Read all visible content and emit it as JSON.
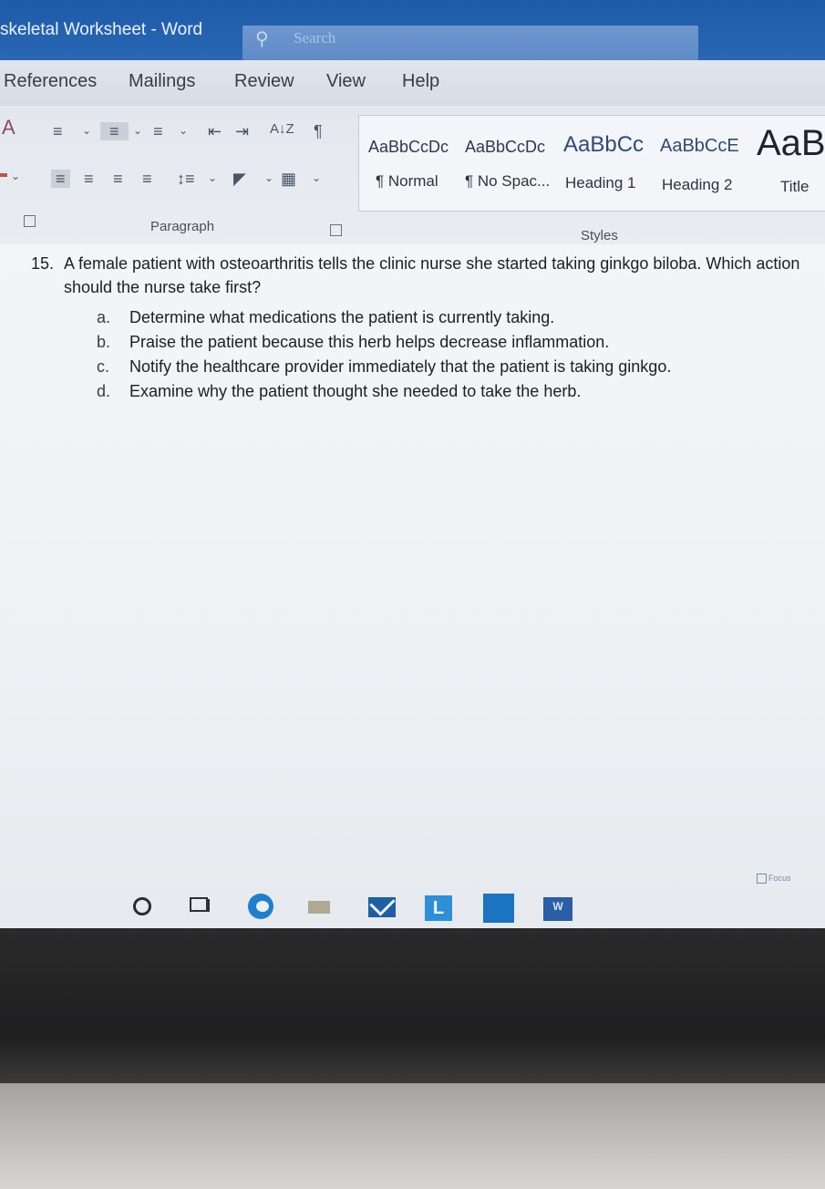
{
  "window": {
    "title": "skeletal Worksheet  -  Word"
  },
  "search": {
    "icon": "search-icon",
    "placeholder": "Search"
  },
  "tabs": [
    {
      "label": "References"
    },
    {
      "label": "Mailings"
    },
    {
      "label": "Review"
    },
    {
      "label": "View"
    },
    {
      "label": "Help"
    }
  ],
  "ribbon": {
    "paragraph": {
      "label": "Paragraph",
      "sort_glyph": "A↓Z",
      "pilcrow": "¶"
    },
    "styles": {
      "label": "Styles",
      "items": [
        {
          "preview": "AaBbCcDc",
          "name": "¶ Normal"
        },
        {
          "preview": "AaBbCcDc",
          "name": "¶ No Spac..."
        },
        {
          "preview": "AaBbCc",
          "name": "Heading 1"
        },
        {
          "preview": "AaBbCcE",
          "name": "Heading 2"
        },
        {
          "preview": "AaB",
          "name": "Title"
        }
      ]
    }
  },
  "document": {
    "question": {
      "number": "15.",
      "stem": "A female patient with osteoarthritis tells the clinic nurse she started taking ginkgo biloba. Which action should the nurse take first?",
      "options": [
        {
          "letter": "a.",
          "text": "Determine what medications the patient is currently taking."
        },
        {
          "letter": "b.",
          "text": "Praise the patient because this herb helps decrease inflammation."
        },
        {
          "letter": "c.",
          "text": "Notify the healthcare provider immediately that the patient is taking ginkgo."
        },
        {
          "letter": "d.",
          "text": "Examine why the patient thought she needed to take the herb."
        }
      ]
    }
  },
  "statusbar": {
    "focus_label": "Focus"
  },
  "taskbar": {
    "icons": [
      "start-circle-icon",
      "task-view-icon",
      "edge-icon",
      "file-explorer-icon",
      "mail-icon",
      "lync-icon",
      "store-icon",
      "word-icon"
    ],
    "lync_letter": "L",
    "word_letter": "W"
  }
}
